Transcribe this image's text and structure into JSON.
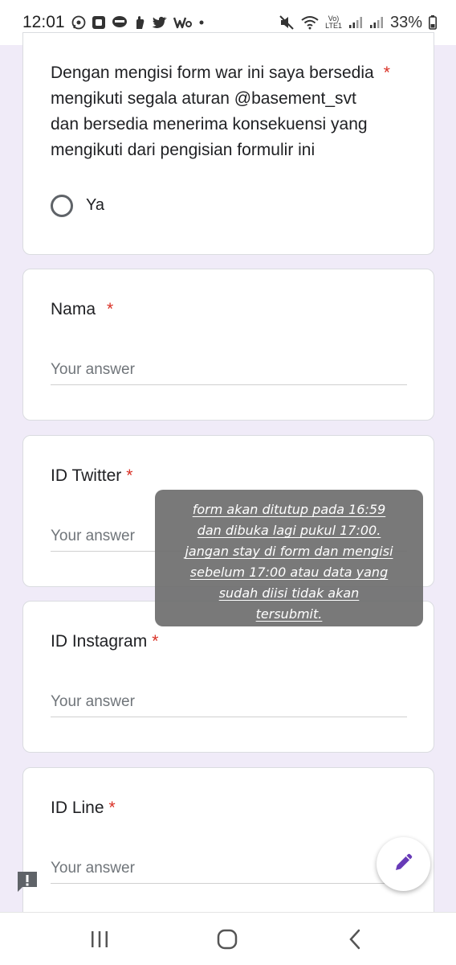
{
  "status_bar": {
    "time": "12:01",
    "left_icons": [
      "whatsapp-icon",
      "app-square-icon",
      "line-icon",
      "hand-icon",
      "twitter-icon",
      "webtoon-icon",
      "dot-icon"
    ],
    "lte_label_top": "Vo)",
    "lte_label_bottom": "LTE1",
    "battery_percent": "33%"
  },
  "agreement": {
    "title_lines": [
      "Dengan mengisi form war ini saya bersedia",
      "mengikuti segala aturan @basement_svt",
      "dan bersedia menerima konsekuensi yang",
      "mengikuti dari pengisian formulir ini"
    ],
    "required_mark": "*",
    "option_label": "Ya"
  },
  "fields": [
    {
      "title": "Nama",
      "required_mark": "*",
      "placeholder": "Your answer"
    },
    {
      "title": "ID Twitter",
      "required_mark": "*",
      "placeholder": "Your answer"
    },
    {
      "title": "ID Instagram",
      "required_mark": "*",
      "placeholder": "Your answer"
    },
    {
      "title": "ID Line",
      "required_mark": "*",
      "placeholder": "Your answer"
    }
  ],
  "toast": {
    "lines": [
      "form akan ditutup pada 16:59",
      "dan dibuka lagi pukul 17:00.",
      "jangan stay di form dan mengisi",
      "sebelum 17:00 atau data yang",
      "sudah diisi tidak akan",
      "tersubmit."
    ]
  },
  "colors": {
    "background": "#f0ebf8",
    "required": "#d93025",
    "accent": "#673ab7"
  }
}
